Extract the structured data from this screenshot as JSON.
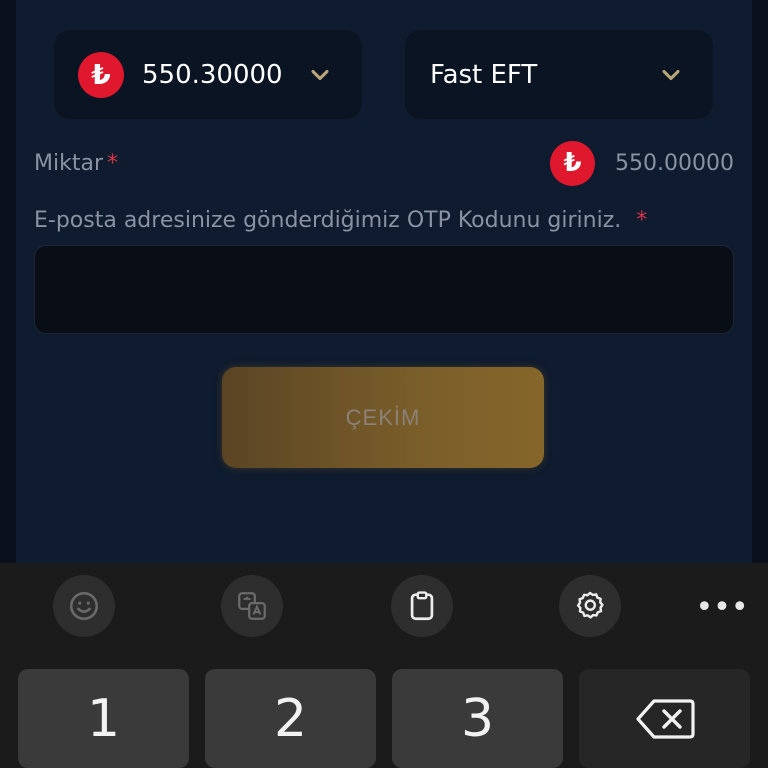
{
  "form": {
    "amount_select": {
      "currency_symbol": "₺",
      "value": "550.30000"
    },
    "method_select": {
      "value": "Fast EFT"
    },
    "amount_label": "Miktar",
    "required_mark": "*",
    "amount_display": {
      "currency_symbol": "₺",
      "value": "550.00000"
    },
    "otp_label": "E-posta adresinize gönderdiğimiz OTP Kodunu giriniz.",
    "otp_value": "",
    "submit_label": "ÇEKİM"
  },
  "keyboard": {
    "toolbar": {
      "more_label": "•••",
      "icons": [
        "emoji-icon",
        "translate-icon",
        "clipboard-icon",
        "settings-icon"
      ]
    },
    "keys": [
      "1",
      "2",
      "3"
    ],
    "delete_icon": "backspace-icon"
  },
  "colors": {
    "background": "#0a101b",
    "panel": "#0f1b2e",
    "lira_badge": "#e0182d",
    "required": "#d8344a",
    "button_gold": "#7a5e2a",
    "keyboard": "#1b1b1b"
  }
}
